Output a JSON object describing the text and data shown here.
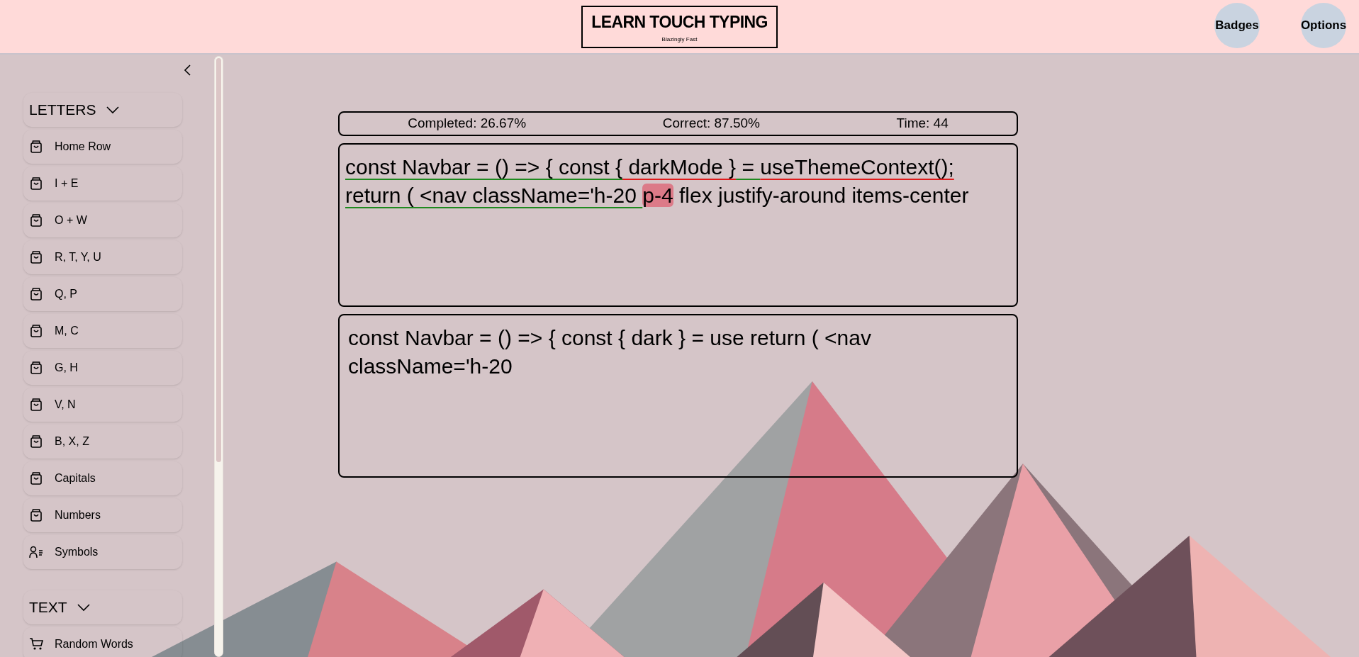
{
  "header": {
    "title": "LEARN TOUCH TYPING",
    "tagline": "Blazingly Fast",
    "buttons": [
      "Badges",
      "Options"
    ]
  },
  "sidebar": {
    "sections": [
      {
        "title": "LETTERS",
        "expanded": true,
        "items": [
          {
            "label": "Home Row",
            "kind": "bag"
          },
          {
            "label": "I + E",
            "kind": "bag"
          },
          {
            "label": "O + W",
            "kind": "bag"
          },
          {
            "label": "R, T, Y, U",
            "kind": "bag"
          },
          {
            "label": "Q, P",
            "kind": "bag"
          },
          {
            "label": "M, C",
            "kind": "bag"
          },
          {
            "label": "G, H",
            "kind": "bag"
          },
          {
            "label": "V, N",
            "kind": "bag"
          },
          {
            "label": "B, X, Z",
            "kind": "bag"
          },
          {
            "label": "Capitals",
            "kind": "bag"
          },
          {
            "label": "Numbers",
            "kind": "bag"
          },
          {
            "label": "Symbols",
            "kind": "person-list"
          }
        ]
      },
      {
        "title": "TEXT",
        "expanded": true,
        "items": [
          {
            "label": "Random Words",
            "kind": "cart"
          }
        ]
      }
    ]
  },
  "stats": [
    "Completed: 26.67%",
    "Correct: 87.50%",
    "Time: 44"
  ],
  "target_text": [
    {
      "text": "const Navbar = () => { const {",
      "typed": true,
      "error": false,
      "current": false
    },
    {
      "text": " darkMode }",
      "typed": true,
      "error": true,
      "current": false
    },
    {
      "text": " = ",
      "typed": true,
      "error": false,
      "current": false
    },
    {
      "text": "useThemeContext();",
      "typed": true,
      "error": true,
      "current": false
    },
    {
      "text": " return ( <nav className='h-20 ",
      "typed": true,
      "error": false,
      "current": false
    },
    {
      "text": "p-4",
      "typed": false,
      "error": false,
      "current": true
    },
    {
      "text": " flex justify-around items-center",
      "typed": false,
      "error": false,
      "current": false
    }
  ],
  "typed_text": "const Navbar = () => { const { dark } = use return ( <nav className='h-20"
}
